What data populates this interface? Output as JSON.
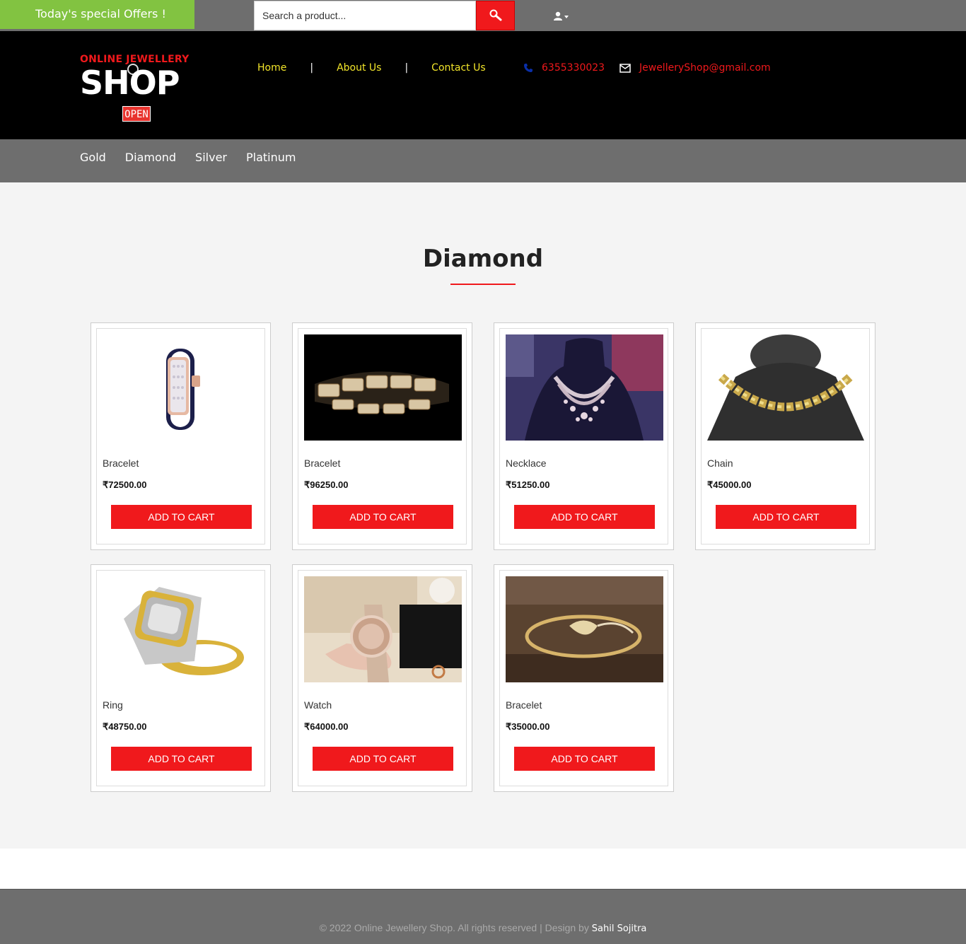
{
  "topbar": {
    "offers_label": "Today's special Offers !",
    "search_placeholder": "Search a product...",
    "search_icon": "search-icon",
    "user_icon": "user-icon",
    "accent_color": "#f0191c",
    "offers_color": "#82c341"
  },
  "logo": {
    "top_text": "ONLINE JEWELLERY",
    "main_text": "SHOP",
    "sign_text": "OPEN"
  },
  "nav": {
    "items": [
      {
        "label": "Home"
      },
      {
        "label": "About Us"
      },
      {
        "label": "Contact Us"
      }
    ],
    "separator": "|"
  },
  "contact": {
    "phone": "6355330023",
    "email": "JewelleryShop@gmail.com"
  },
  "categories": [
    "Gold",
    "Diamond",
    "Silver",
    "Platinum"
  ],
  "main": {
    "title": "Diamond",
    "add_to_cart_label": "ADD TO CART",
    "products": [
      {
        "name": "Bracelet",
        "price": "₹72500.00",
        "image": "bracelet-blue-strap"
      },
      {
        "name": "Bracelet",
        "price": "₹96250.00",
        "image": "bracelet-links-black-bg"
      },
      {
        "name": "Necklace",
        "price": "₹51250.00",
        "image": "necklace-on-bust"
      },
      {
        "name": "Chain",
        "price": "₹45000.00",
        "image": "gold-chain-on-bust"
      },
      {
        "name": "Ring",
        "price": "₹48750.00",
        "image": "diamond-ring"
      },
      {
        "name": "Watch",
        "price": "₹64000.00",
        "image": "michael-kors-watch"
      },
      {
        "name": "Bracelet",
        "price": "₹35000.00",
        "image": "bracelet-on-wood"
      }
    ]
  },
  "footer": {
    "copyright": "© 2022 Online Jewellery Shop. All rights reserved | Design by",
    "author": "Sahil Sojitra"
  }
}
